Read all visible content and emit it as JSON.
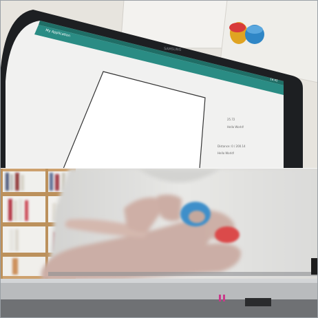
{
  "photos": [
    {
      "subject": "tablet-app-photo",
      "app_title": "My Application",
      "tablet_brand": "SAMSUNG",
      "status_time": "16:45",
      "side_text": [
        "25.72",
        "Hello World!",
        "Distance: 0 / 200.14",
        "Hello World!"
      ]
    },
    {
      "subject": "hand-with-rings-photo"
    }
  ],
  "colors": {
    "app_bar": "#2a8c84",
    "status_bar": "#1f6e66",
    "tablet_bezel": "#1d1f22",
    "red_token": "#d83a3a",
    "blue_token": "#2f86c6",
    "led": "#c93a8a"
  }
}
